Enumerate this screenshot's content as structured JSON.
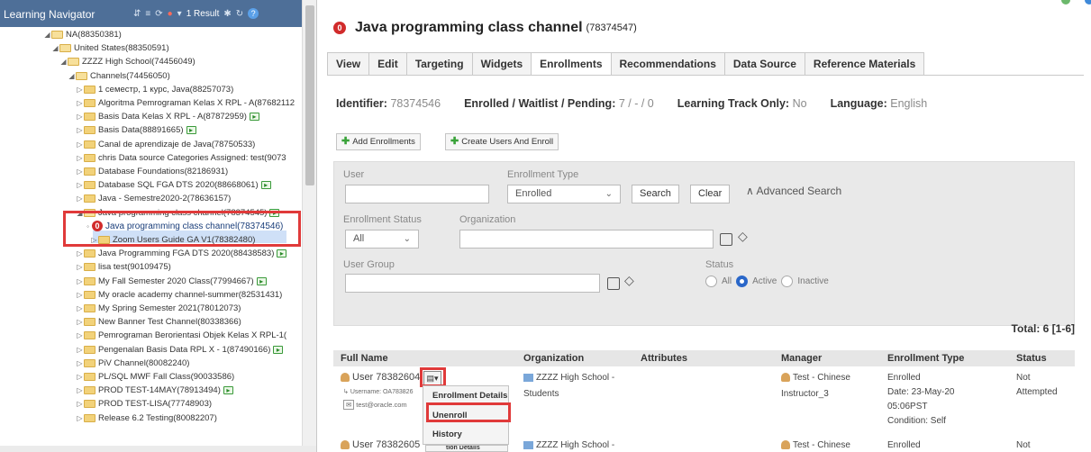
{
  "navigator": {
    "title": "Learning Navigator",
    "result_text": "1 Result",
    "tree": [
      {
        "label": "NA(88350381)",
        "open": true
      },
      {
        "label": "United States(88350591)",
        "open": true
      },
      {
        "label": "ZZZZ High School(74456049)",
        "open": true
      },
      {
        "label": "Channels(74456050)",
        "open": true
      },
      {
        "label": "1 семестр, 1 курс, Java(88257073)"
      },
      {
        "label": "Algoritma Pemrograman Kelas X RPL - A(87682112"
      },
      {
        "label": "Basis Data Kelas X RPL - A(87872959)",
        "badge": true
      },
      {
        "label": "Basis Data(88891665)",
        "badge": true
      },
      {
        "label": "Canal de aprendizaje de Java(78750533)"
      },
      {
        "label": "chris Data source Categories Assigned: test(9073"
      },
      {
        "label": "Database Foundations(82186931)"
      },
      {
        "label": "Database SQL FGA DTS 2020(88668061)",
        "badge": true
      },
      {
        "label": "Java - Semestre2020-2(78636157)"
      },
      {
        "label": "Java programming class channel(78374545)",
        "badge": true,
        "open": true
      },
      {
        "label": "Java programming class channel(78374546)",
        "selected": true
      },
      {
        "label": "Zoom Users Guide GA V1(78382480)"
      },
      {
        "label": "Java Programming FGA DTS 2020(88438583)",
        "badge": true
      },
      {
        "label": "lisa test(90109475)"
      },
      {
        "label": "My Fall Semester 2020 Class(77994667)",
        "badge": true
      },
      {
        "label": "My oracle academy channel-summer(82531431)"
      },
      {
        "label": "My Spring Semester 2021(78012073)"
      },
      {
        "label": "New Banner Test Channel(80338366)"
      },
      {
        "label": "Pemrograman Berorientasi Objek Kelas X RPL-1("
      },
      {
        "label": "Pengenalan Basis Data RPL X - 1(87490166)",
        "badge": true
      },
      {
        "label": "PiV Channel(80082240)"
      },
      {
        "label": "PL/SQL MWF Fall Class(90033586)"
      },
      {
        "label": "PROD TEST-14MAY(78913494)",
        "badge": true
      },
      {
        "label": "PROD TEST-LISA(77748903)"
      },
      {
        "label": "Release 6.2 Testing(80082207)"
      }
    ]
  },
  "page": {
    "title": "Java programming class channel",
    "title_id": "(78374547)",
    "tabs": [
      "View",
      "Edit",
      "Targeting",
      "Widgets",
      "Enrollments",
      "Recommendations",
      "Data Source",
      "Reference Materials"
    ],
    "active_tab": "Enrollments",
    "info": {
      "identifier_label": "Identifier:",
      "identifier_value": "78374546",
      "enrolled_label": "Enrolled / Waitlist / Pending:",
      "enrolled_value": "7 / - / 0",
      "track_label": "Learning Track Only:",
      "track_value": "No",
      "language_label": "Language:",
      "language_value": "English"
    },
    "buttons": {
      "add": "Add Enrollments",
      "create": "Create Users And Enroll"
    }
  },
  "filters": {
    "user_label": "User",
    "enrollment_type_label": "Enrollment Type",
    "enrollment_type_value": "Enrolled",
    "search": "Search",
    "clear": "Clear",
    "advanced": "Advanced Search",
    "enrollment_status_label": "Enrollment Status",
    "enrollment_status_value": "All",
    "organization_label": "Organization",
    "user_group_label": "User Group",
    "status_label": "Status",
    "status_options": [
      "All",
      "Active",
      "Inactive"
    ]
  },
  "table": {
    "total": "Total: 6 [1-6]",
    "headers": [
      "Full Name",
      "Organization",
      "Attributes",
      "Manager",
      "Enrollment Type",
      "Status"
    ],
    "row1": {
      "name": "User 78382604",
      "username": "Username: OA783826",
      "email": "test@oracle.com",
      "org": "ZZZZ High School -",
      "org2": "Students",
      "manager": "Test - Chinese",
      "manager2": "Instructor_3",
      "etype": "Enrolled",
      "date": "Date: 23-May-20",
      "time": "05:06PST",
      "condition": "Condition: Self",
      "status": "Not",
      "status2": "Attempted"
    },
    "row2": {
      "name": "User 78382605",
      "org": "ZZZZ High School -",
      "manager": "Test - Chinese",
      "etype": "Enrolled",
      "status": "Not"
    }
  },
  "menu": {
    "details": "Enrollment Details",
    "unenroll": "Unenroll",
    "history": "History",
    "details2": "tion Details"
  }
}
